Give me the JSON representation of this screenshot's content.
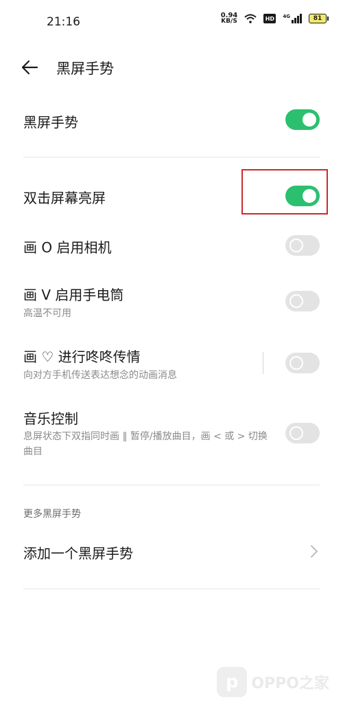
{
  "status_bar": {
    "time": "21:16",
    "net_speed_value": "0.94",
    "net_speed_unit": "KB/S",
    "hd_label": "HD",
    "network_label": "4G",
    "battery": "81",
    "icons": [
      "wifi-icon",
      "hd-icon",
      "signal-icon",
      "battery-icon"
    ]
  },
  "header": {
    "title": "黑屏手势",
    "back_icon": "back-arrow-icon"
  },
  "settings": [
    {
      "title": "黑屏手势",
      "subtitle": "",
      "enabled": true
    },
    {
      "title": "双击屏幕亮屏",
      "subtitle": "",
      "enabled": true
    },
    {
      "title": "画 O 启用相机",
      "subtitle": "",
      "enabled": false
    },
    {
      "title": "画 V 启用手电筒",
      "subtitle": "高温不可用",
      "enabled": false
    },
    {
      "title": "画 ♡ 进行咚咚传情",
      "subtitle": "向对方手机传送表达想念的动画消息",
      "enabled": false
    },
    {
      "title": "音乐控制",
      "subtitle": "息屏状态下双指同时画 ‖ 暂停/播放曲目，画 < 或 > 切换曲目",
      "enabled": false
    }
  ],
  "more_section": {
    "label": "更多黑屏手势",
    "add_item": "添加一个黑屏手势",
    "chevron_icon": "chevron-right-icon"
  },
  "watermark": {
    "logo_letter": "p",
    "text": "OPPO之家"
  },
  "colors": {
    "toggle_on": "#2ac06f",
    "toggle_off": "#e3e3e3",
    "highlight_border": "#cc2a2a"
  }
}
